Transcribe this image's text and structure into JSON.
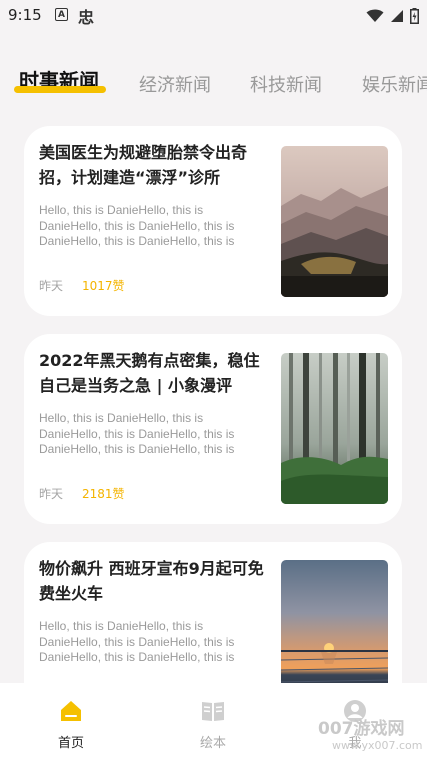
{
  "status_bar": {
    "time": "9:15",
    "notification_a": "A",
    "notification_cn": "忠"
  },
  "tabs": [
    {
      "label": "时事新闻",
      "active": true
    },
    {
      "label": "经济新闻",
      "active": false
    },
    {
      "label": "科技新闻",
      "active": false
    },
    {
      "label": "娱乐新闻",
      "active": false
    }
  ],
  "articles": [
    {
      "title": "美国医生为规避堕胎禁令出奇招，计划建造“漂浮”诊所",
      "desc": "Hello, this is DanieHello, this is DanieHello, this is DanieHello, this is DanieHello, this is DanieHello, this is",
      "date": "昨天",
      "likes": "1017赞",
      "image": "misty-mountain-landscape"
    },
    {
      "title": "2022年黑天鹅有点密集，稳住自己是当务之急 | 小象漫评",
      "desc": "Hello, this is DanieHello, this is DanieHello, this is DanieHello, this is DanieHello, this is DanieHello, this is",
      "date": "昨天",
      "likes": "2181赞",
      "image": "misty-forest"
    },
    {
      "title": "物价飙升 西班牙宣布9月起可免费坐火车",
      "desc": "Hello, this is DanieHello, this is DanieHello, this is DanieHello, this is DanieHello, this is DanieHello, this is",
      "date": "",
      "likes": "",
      "image": "sunset-over-sea"
    }
  ],
  "bottom_nav": [
    {
      "label": "首页",
      "icon": "home-icon",
      "active": true
    },
    {
      "label": "绘本",
      "icon": "book-icon",
      "active": false
    },
    {
      "label": "我",
      "icon": "profile-icon",
      "active": false
    }
  ],
  "watermark": {
    "text": "007游戏网",
    "sub": "www.yx007.com"
  },
  "colors": {
    "accent": "#f5c000",
    "likes": "#f4b400",
    "background": "#f5f3f4"
  }
}
